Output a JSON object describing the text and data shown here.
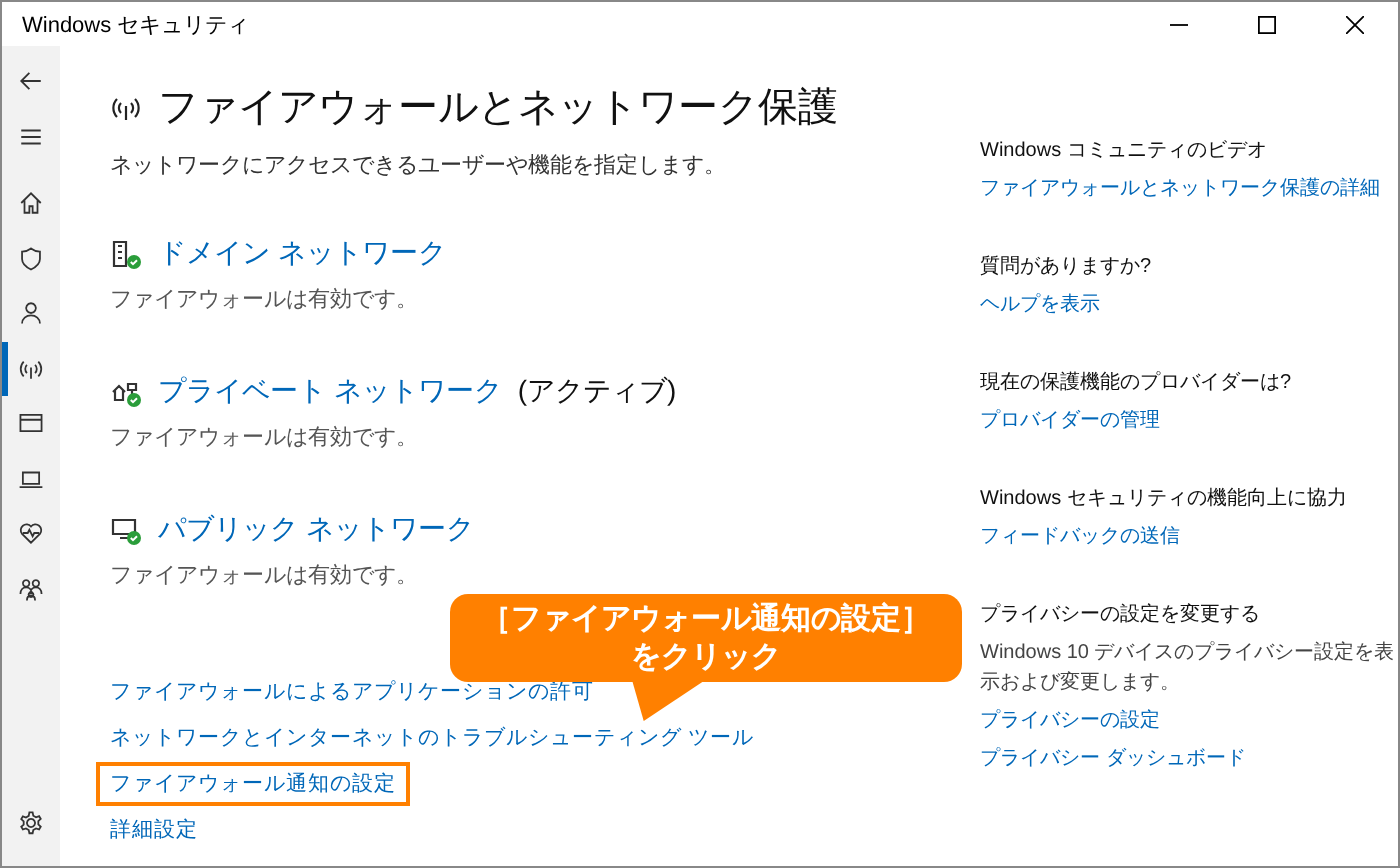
{
  "window": {
    "title": "Windows セキュリティ"
  },
  "sidebar": {
    "items": [
      {
        "kind": "back",
        "selected": false
      },
      {
        "kind": "menu",
        "selected": false
      },
      {
        "kind": "home",
        "selected": false
      },
      {
        "kind": "shield",
        "selected": false
      },
      {
        "kind": "person",
        "selected": false
      },
      {
        "kind": "antenna",
        "selected": true
      },
      {
        "kind": "window",
        "selected": false
      },
      {
        "kind": "laptop",
        "selected": false
      },
      {
        "kind": "heart",
        "selected": false
      },
      {
        "kind": "family",
        "selected": false
      },
      {
        "kind": "gear",
        "selected": false
      }
    ]
  },
  "page": {
    "title": "ファイアウォールとネットワーク保護",
    "description": "ネットワークにアクセスできるユーザーや機能を指定します。",
    "networks": [
      {
        "kind": "domain",
        "name": "ドメイン ネットワーク",
        "status": "ファイアウォールは有効です。"
      },
      {
        "kind": "private",
        "name": "プライベート ネットワーク",
        "suffix": "(アクティブ)",
        "status": "ファイアウォールは有効です。"
      },
      {
        "kind": "public",
        "name": "パブリック ネットワーク",
        "status": "ファイアウォールは有効です。"
      }
    ],
    "links": [
      {
        "label": "ファイアウォールによるアプリケーションの許可",
        "highlighted": false
      },
      {
        "label": "ネットワークとインターネットのトラブルシューティング ツール",
        "highlighted": false
      },
      {
        "label": "ファイアウォール通知の設定",
        "highlighted": true
      },
      {
        "label": "詳細設定",
        "highlighted": false
      }
    ]
  },
  "side": {
    "sections": [
      {
        "heading": "Windows コミュニティのビデオ",
        "links": [
          "ファイアウォールとネットワーク保護の詳細"
        ]
      },
      {
        "heading": "質問がありますか?",
        "links": [
          "ヘルプを表示"
        ]
      },
      {
        "heading": "現在の保護機能のプロバイダーは?",
        "links": [
          "プロバイダーの管理"
        ]
      },
      {
        "heading": "Windows セキュリティの機能向上に協力",
        "links": [
          "フィードバックの送信"
        ]
      },
      {
        "heading": "プライバシーの設定を変更する",
        "body": "Windows 10 デバイスのプライバシー設定を表示および変更します。",
        "links": [
          "プライバシーの設定",
          "プライバシー ダッシュボード"
        ]
      }
    ]
  },
  "callout": {
    "lines": [
      "［ファイアウォール通知の設定］",
      "をクリック"
    ]
  }
}
